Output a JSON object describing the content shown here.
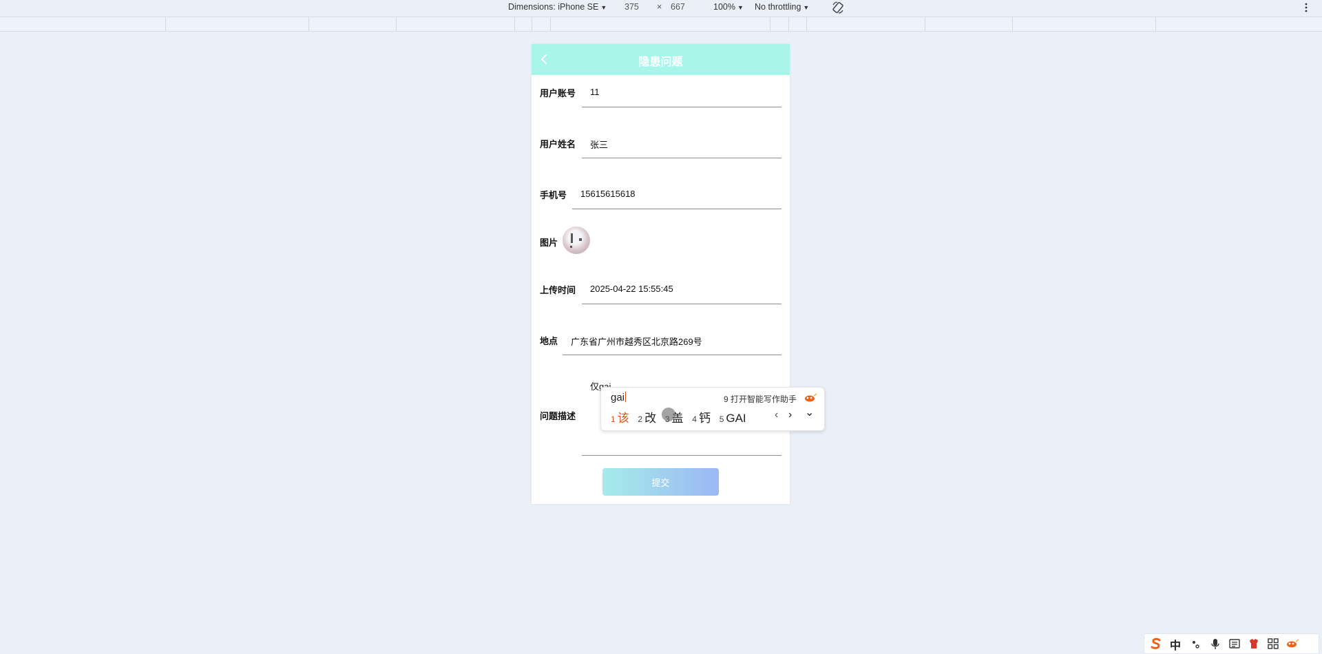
{
  "devtools": {
    "device_label": "Dimensions: iPhone SE",
    "width": "375",
    "times": "×",
    "height": "667",
    "zoom": "100%",
    "throttling": "No throttling"
  },
  "page": {
    "title": "隐患问题",
    "fields": {
      "account": {
        "label": "用户账号",
        "value": "11"
      },
      "name": {
        "label": "用户姓名",
        "value": "张三"
      },
      "phone": {
        "label": "手机号",
        "value": "15615615618"
      },
      "photo": {
        "label": "图片"
      },
      "time": {
        "label": "上传时间",
        "value": "2025-04-22 15:55:45"
      },
      "location": {
        "label": "地点",
        "value": "广东省广州市越秀区北京路269号"
      },
      "description": {
        "label": "问题描述",
        "value": "仅gai"
      }
    },
    "submit_label": "提交"
  },
  "ime": {
    "pinyin": "gai",
    "assistant": "9 打开智能写作助手",
    "candidates": [
      {
        "num": "1",
        "text": "该"
      },
      {
        "num": "2",
        "text": "改"
      },
      {
        "num": "3",
        "text": "盖"
      },
      {
        "num": "4",
        "text": "钙"
      },
      {
        "num": "5",
        "text": "GAI"
      }
    ],
    "prev": "‹",
    "next": "›",
    "expand": "⌄"
  },
  "tray": {
    "lang": "中",
    "colors": {
      "sogou": "#e8621c",
      "accent": "#d9541a"
    }
  }
}
